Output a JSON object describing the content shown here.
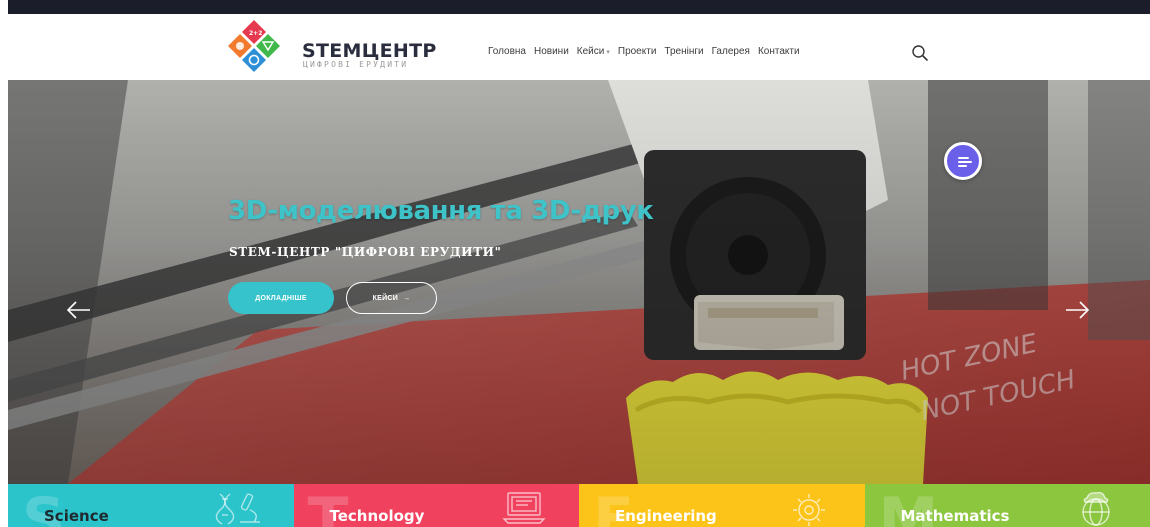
{
  "logo": {
    "title": "STEMЦЕНТР",
    "subtitle": "ЦИФРОВІ ЕРУДИТИ"
  },
  "nav": [
    {
      "label": "Головна"
    },
    {
      "label": "Новини"
    },
    {
      "label": "Кейси",
      "has_dropdown": true
    },
    {
      "label": "Проекти"
    },
    {
      "label": "Тренінги"
    },
    {
      "label": "Галерея"
    },
    {
      "label": "Контакти"
    }
  ],
  "hero": {
    "title": "3D-моделювання та 3D-друк",
    "subtitle": "STEM-ЦЕНТР \"ЦИФРОВІ ЕРУДИТИ\"",
    "primary_button": "ДОКЛАДНІШЕ",
    "secondary_button": "КЕЙСИ",
    "secondary_arrow": "→"
  },
  "colors": {
    "accent": "#37c3cb",
    "fab": "#6a5fe8",
    "science": "#2cc4cb",
    "technology": "#f0425f",
    "engineering": "#fcc419",
    "mathematics": "#8cc63f"
  },
  "stem_cards": [
    {
      "label": "Science",
      "letter": "S",
      "icon": "dna-microscope-icon",
      "label_color": "#1e2a2f"
    },
    {
      "label": "Technology",
      "letter": "T",
      "icon": "laptop-icon",
      "label_color": "#ffffff"
    },
    {
      "label": "Engineering",
      "letter": "E",
      "icon": "gear-icon",
      "label_color": "#ffffff"
    },
    {
      "label": "Mathematics",
      "letter": "M",
      "icon": "globe-cloud-icon",
      "label_color": "#ffffff"
    }
  ]
}
